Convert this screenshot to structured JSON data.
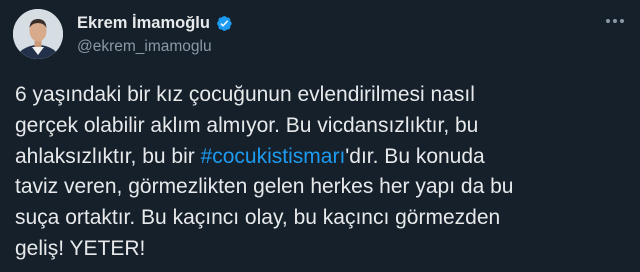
{
  "author": {
    "display_name": "Ekrem İmamoğlu",
    "handle": "@ekrem_imamoglu",
    "verified": true
  },
  "tweet": {
    "line1": "6 yaşındaki bir kız çocuğunun evlendirilmesi nasıl",
    "line2": "gerçek olabilir aklım almıyor. Bu vicdansızlıktır, bu",
    "line3_before": "ahlaksızlıktır, bu bir ",
    "hashtag": "#cocukistismarı",
    "line3_after": "'dır. Bu konuda",
    "line4": "taviz veren, görmezlikten gelen herkes her yapı da bu",
    "line5": "suça ortaktır. Bu kaçıncı olay, bu kaçıncı görmezden",
    "line6": "geliş! YETER!"
  },
  "colors": {
    "background": "#15202b",
    "text": "#e7e9ea",
    "secondary": "#8b98a5",
    "accent": "#1d9bf0"
  },
  "icons": {
    "verified": "verified-badge-icon",
    "more": "more-horizontal-icon"
  }
}
